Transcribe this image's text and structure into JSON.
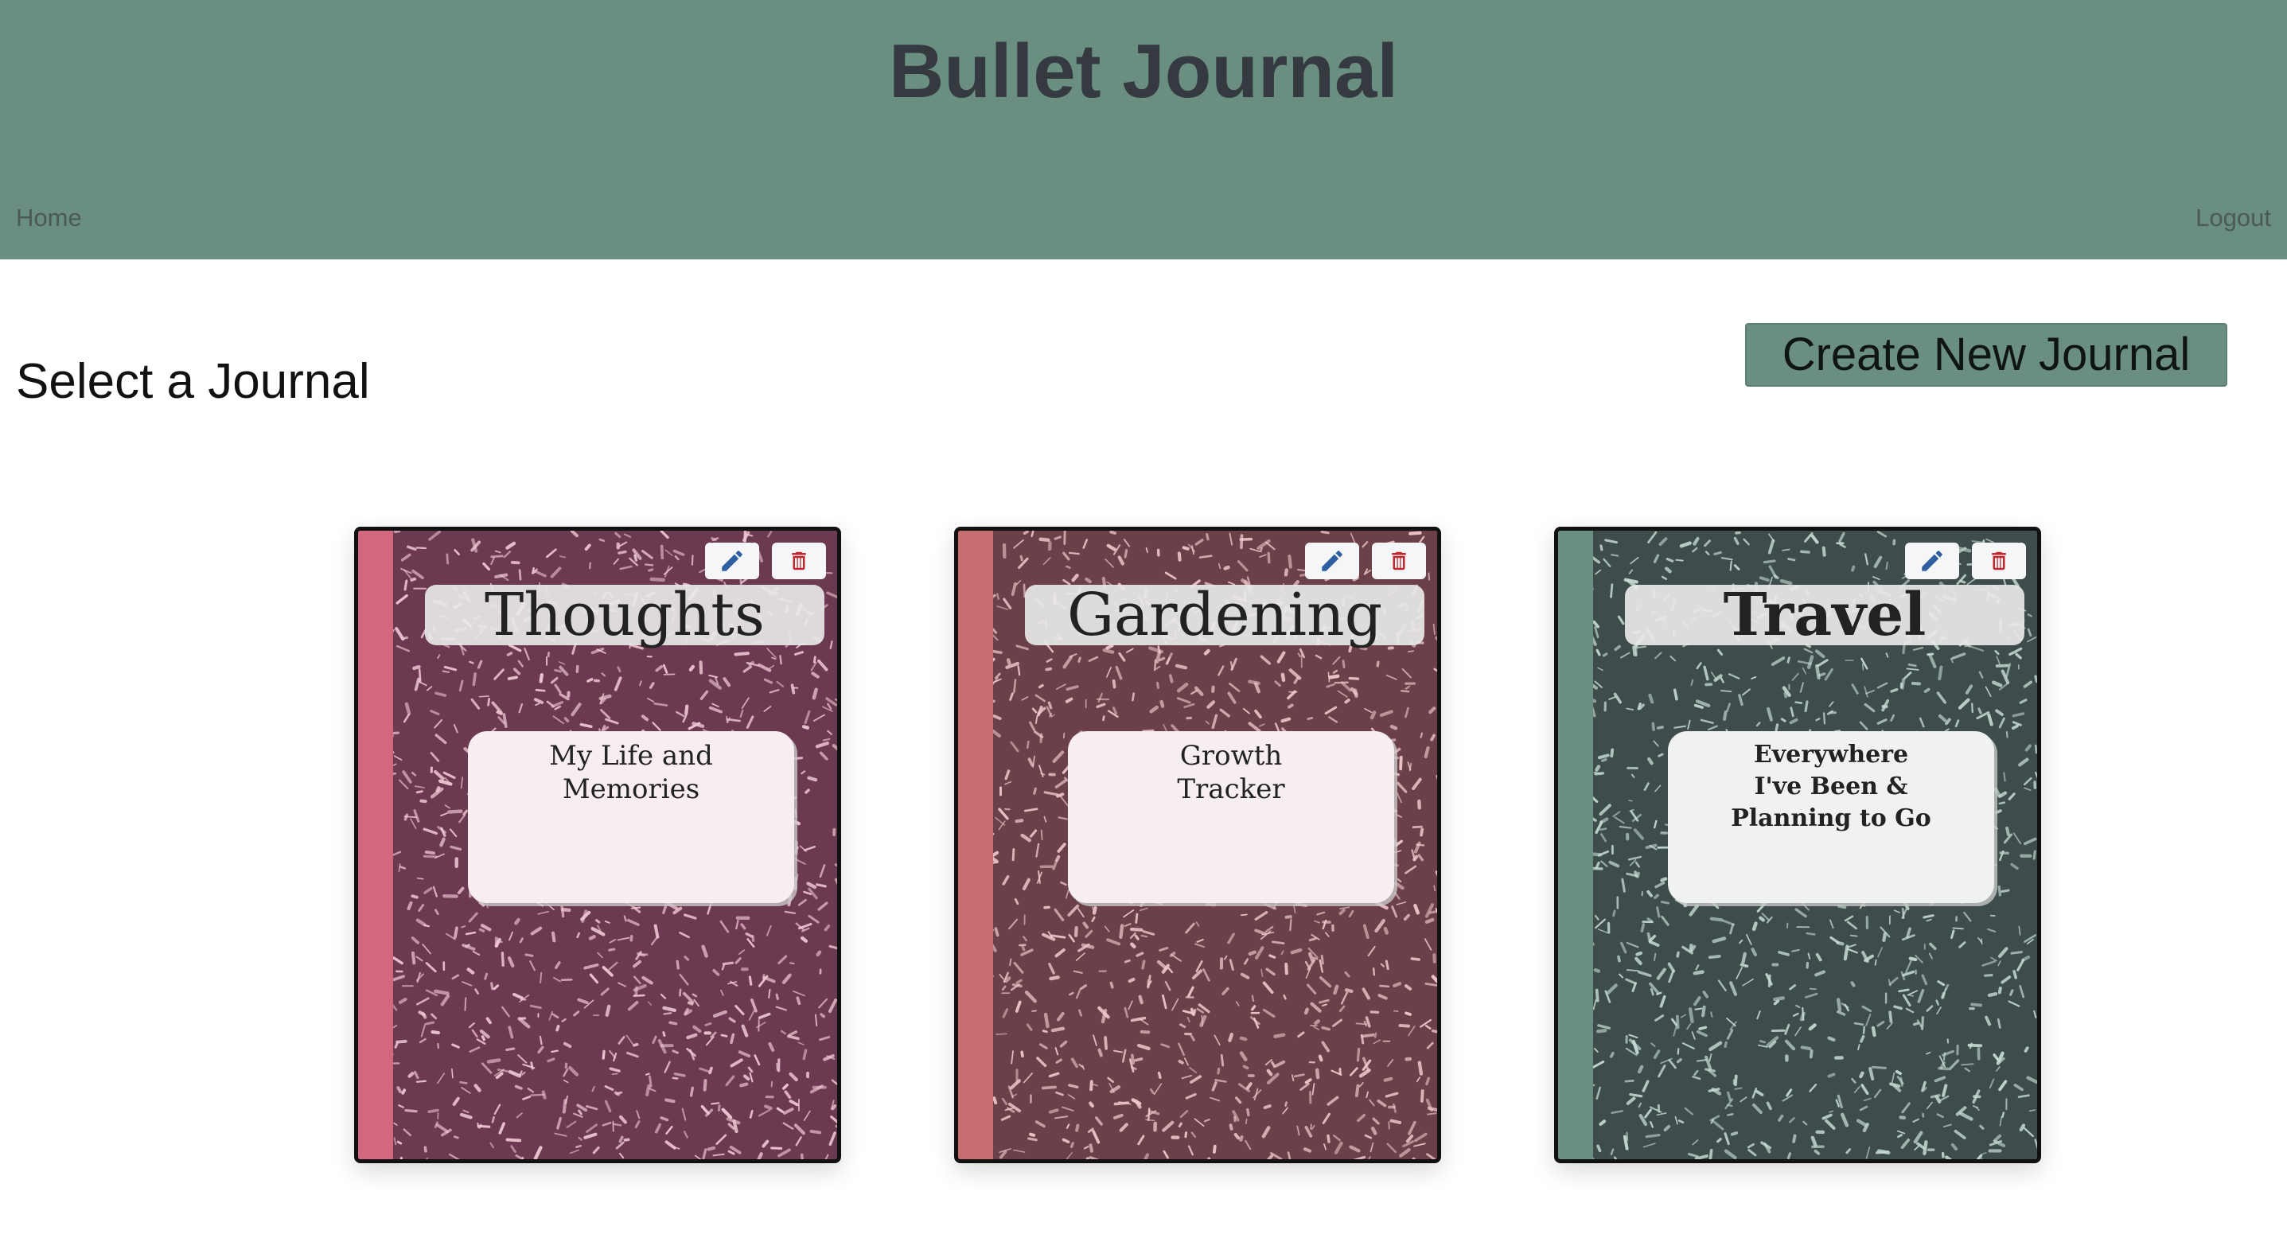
{
  "app": {
    "title": "Bullet Journal"
  },
  "nav": {
    "home_label": "Home",
    "logout_label": "Logout"
  },
  "main": {
    "heading": "Select a Journal",
    "create_button_label": "Create New Journal"
  },
  "journals": [
    {
      "title": "Thoughts",
      "description_lines": [
        "My Life and",
        "Memories"
      ],
      "cover_color": "#6b3a50",
      "spine_color": "#d3677f",
      "speckle_color": "#f0c8d4",
      "label_color": "#f8eef2",
      "icons": [
        "pencil-icon",
        "trash-icon"
      ]
    },
    {
      "title": "Gardening",
      "description_lines": [
        "Growth",
        "Tracker"
      ],
      "cover_color": "#6b4048",
      "spine_color": "#c66e6f",
      "speckle_color": "#f0c8cc",
      "label_color": "#f6eef0",
      "icons": [
        "pencil-icon",
        "trash-icon"
      ]
    },
    {
      "title": "Travel",
      "description_lines": [
        "Everywhere",
        "I've Been &",
        "Planning to Go"
      ],
      "cover_color": "#3e4d4b",
      "spine_color": "#6a8e7f",
      "speckle_color": "#c6dbd4",
      "label_color": "#f0f2f1",
      "icons": [
        "pencil-icon",
        "trash-icon"
      ]
    }
  ],
  "colors": {
    "header_bg": "#6a8e7f",
    "edit_icon": "#2f5f9e",
    "delete_icon": "#c0262d"
  }
}
